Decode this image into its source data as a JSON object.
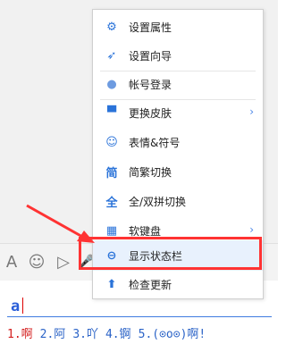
{
  "menu": {
    "items": [
      {
        "label": "设置属性",
        "icon": "gear-icon",
        "glyph": "⚙"
      },
      {
        "label": "设置向导",
        "icon": "rocket-icon",
        "glyph": "➶"
      },
      {
        "label": "帐号登录",
        "icon": "user-icon",
        "glyph": "●"
      },
      {
        "label": "更换皮肤",
        "icon": "shirt-icon",
        "glyph": "▀",
        "submenu": true
      },
      {
        "label": "表情&符号",
        "icon": "smiley-icon",
        "glyph": "☺"
      },
      {
        "label": "简繁切换",
        "icon": "simplified-traditional-icon",
        "glyph": "简"
      },
      {
        "label": "全/双拼切换",
        "icon": "quanpin-icon",
        "glyph": "全"
      },
      {
        "label": "软键盘",
        "icon": "keyboard-icon",
        "glyph": "▦",
        "submenu": true
      },
      {
        "label": "显示状态栏",
        "icon": "minus-circle-icon",
        "glyph": "⊖",
        "highlighted": true
      },
      {
        "label": "检查更新",
        "icon": "arrow-up-icon",
        "glyph": "⬆"
      }
    ],
    "submenu_arrow": "›"
  },
  "toolbar": {
    "font_glyph": "A",
    "emoji_glyph": "☺",
    "video_glyph": "▷",
    "mic_glyph": "🎤"
  },
  "ime": {
    "typed": "a",
    "candidates": [
      "1.啊",
      "2.阿",
      "3.吖",
      "4.锕",
      "5.(⊙o⊙)啊!"
    ]
  },
  "colors": {
    "annotation_red": "#ff3333",
    "icon_blue": "#2a73d9",
    "candidate_first": "#d41f1f",
    "candidate_other": "#2b63c7"
  }
}
